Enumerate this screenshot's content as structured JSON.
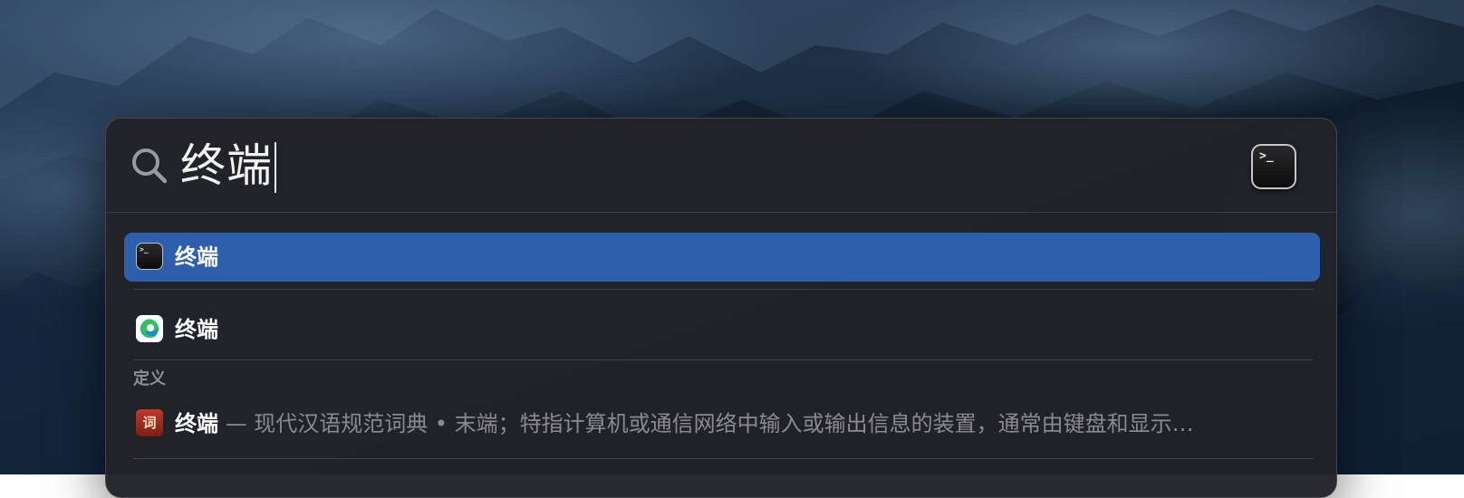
{
  "search": {
    "query": "终端"
  },
  "results": {
    "top_hit": {
      "label": "终端",
      "icon": "terminal-icon",
      "selected": true
    },
    "second": {
      "label": "终端",
      "icon": "edge-browser-icon"
    }
  },
  "definition_section": {
    "title": "定义",
    "term": "终端",
    "separator": " — ",
    "source": "现代汉语规范词典",
    "bullet": " • ",
    "definition": "末端；特指计算机或通信网络中输入或输出信息的装置，通常由键盘和显示…",
    "icon": "dictionary-icon",
    "icon_glyph": "词"
  },
  "colors": {
    "selection": "#2d5fad",
    "panel": "#212328",
    "muted_text": "#8a8a8e"
  }
}
